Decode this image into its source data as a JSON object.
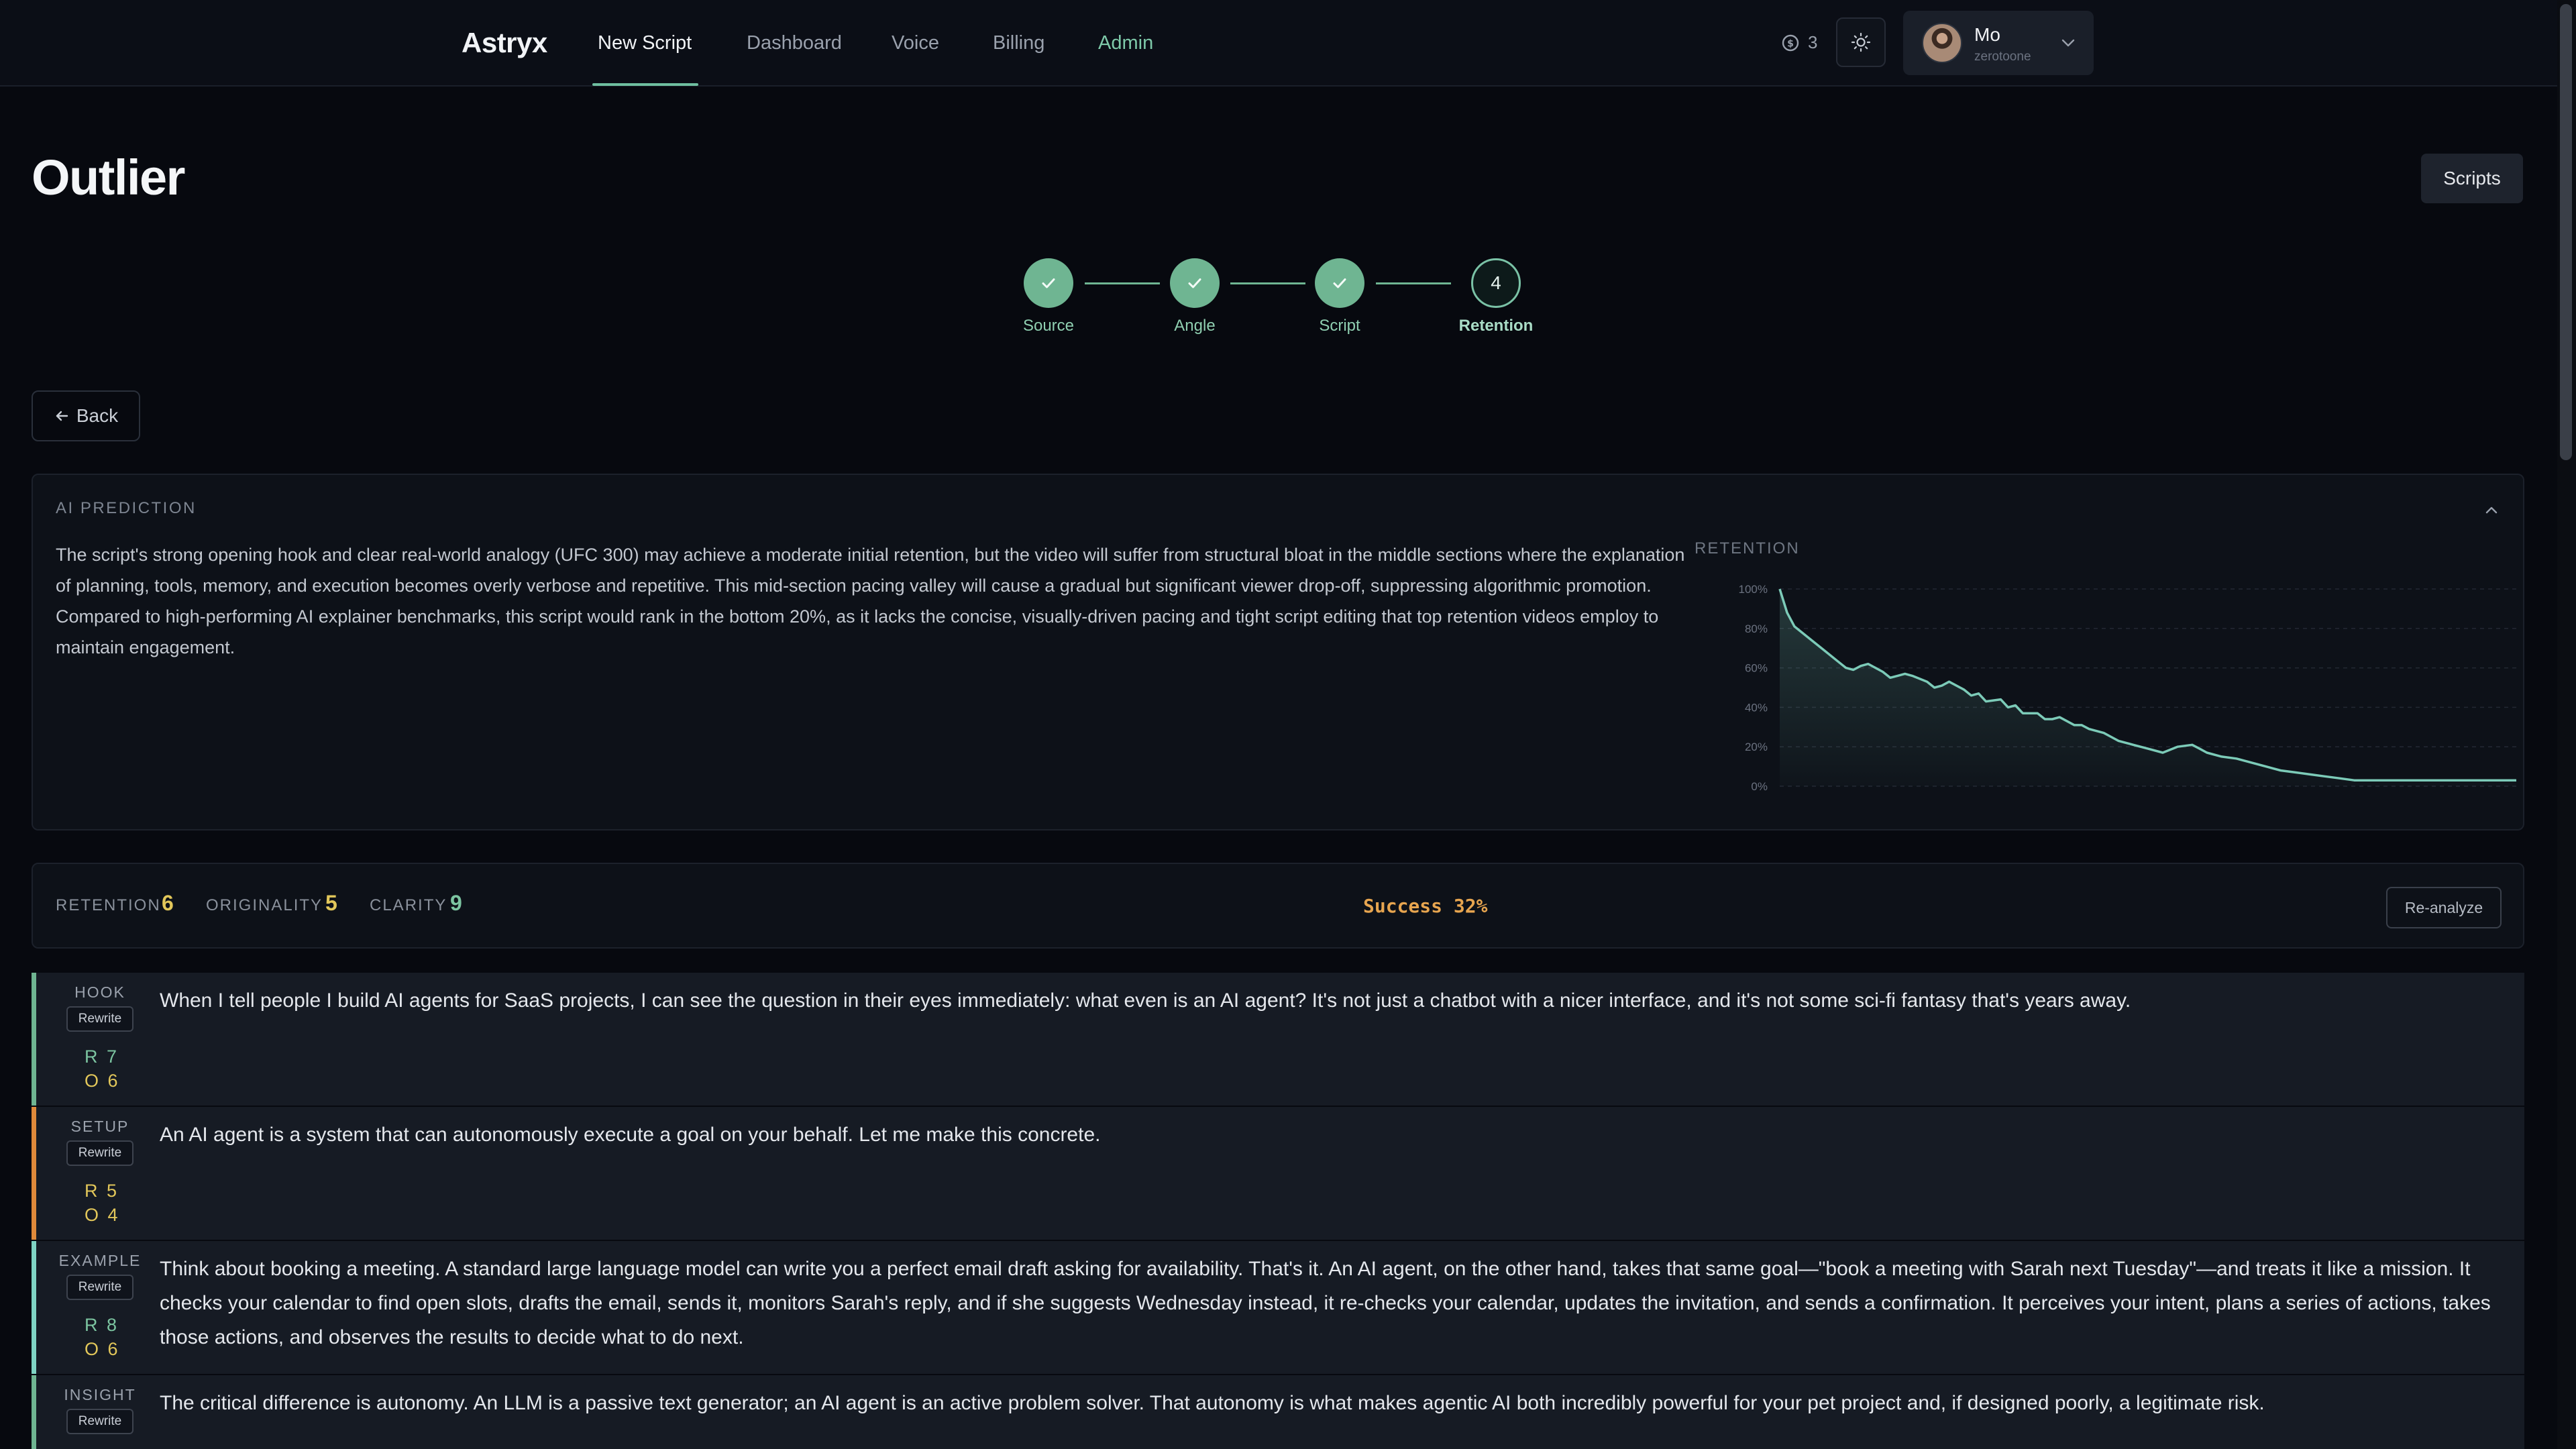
{
  "nav": {
    "brand": "Astryx",
    "items": [
      "New Script",
      "Dashboard",
      "Voice",
      "Billing",
      "Admin"
    ],
    "credits": "3",
    "user": {
      "name": "Mo",
      "handle": "zerotoone"
    }
  },
  "page": {
    "title": "Outlier",
    "scripts_button": "Scripts",
    "back_button": "Back"
  },
  "stepper": {
    "steps": [
      {
        "label": "Source",
        "state": "done"
      },
      {
        "label": "Angle",
        "state": "done"
      },
      {
        "label": "Script",
        "state": "done"
      },
      {
        "label": "Retention",
        "state": "current",
        "number": "4"
      }
    ]
  },
  "prediction": {
    "title": "AI PREDICTION",
    "text": "The script's strong opening hook and clear real-world analogy (UFC 300) may achieve a moderate initial retention, but the video will suffer from structural bloat in the middle sections where the explanation of planning, tools, memory, and execution becomes overly verbose and repetitive. This mid-section pacing valley will cause a gradual but significant viewer drop-off, suppressing algorithmic promotion. Compared to high-performing AI explainer benchmarks, this script would rank in the bottom 20%, as it lacks the concise, visually-driven pacing and tight script editing that top retention videos employ to maintain engagement.",
    "chart_label": "RETENTION"
  },
  "chart_data": {
    "type": "area",
    "title": "RETENTION",
    "xlabel": "",
    "ylabel": "",
    "y_ticks": [
      "100%",
      "80%",
      "60%",
      "40%",
      "20%",
      "0%"
    ],
    "ylim": [
      0,
      100
    ],
    "xlim": [
      0,
      100
    ],
    "grid": true,
    "line_color": "#7ccbb8",
    "series": [
      {
        "x": [
          0,
          1,
          2,
          4,
          6,
          8,
          9,
          10,
          11,
          12,
          14,
          15,
          16,
          17,
          18,
          20,
          21,
          22,
          23,
          25,
          26,
          27,
          28,
          30,
          31,
          32,
          33,
          35,
          36,
          37,
          38,
          40,
          41,
          42,
          44,
          45,
          46,
          48,
          50,
          52,
          54,
          56,
          57,
          58,
          60,
          62,
          64,
          66,
          68,
          70,
          72,
          74,
          76,
          78,
          80,
          82,
          84,
          86,
          88,
          90,
          92,
          94,
          96,
          98,
          100
        ],
        "y": [
          100,
          88,
          81,
          75,
          69,
          63,
          60,
          59,
          61,
          62,
          58,
          55,
          56,
          57,
          56,
          53,
          50,
          51,
          53,
          49,
          46,
          47,
          43,
          44,
          40,
          41,
          37,
          37,
          34,
          34,
          35,
          31,
          31,
          29,
          27,
          25,
          23,
          21,
          19,
          17,
          20,
          21,
          19,
          17,
          15,
          14,
          12,
          10,
          8,
          7,
          6,
          5,
          4,
          3,
          3,
          3,
          3,
          3,
          3,
          3,
          3,
          3,
          3,
          3,
          3
        ]
      }
    ]
  },
  "scores": {
    "items": [
      {
        "label": "RETENTION",
        "value": "6",
        "color": "#e2c75a"
      },
      {
        "label": "ORIGINALITY",
        "value": "5",
        "color": "#e2c75a"
      },
      {
        "label": "CLARITY",
        "value": "9",
        "color": "#7cc5a1"
      }
    ],
    "success": "Success 32%",
    "reanalyze_button": "Re-analyze"
  },
  "sections": [
    {
      "tag": "HOOK",
      "rewrite": "Rewrite",
      "r": "R 7",
      "o": "O 6",
      "border": "#6fb592",
      "r_color": "#7cc5a1",
      "o_color": "#e2c75a",
      "text": "When I tell people I build AI agents for SaaS projects, I can see the question in their eyes immediately: what even is an AI agent? It's not just a chatbot with a nicer interface, and it's not some sci-fi fantasy that's years away."
    },
    {
      "tag": "SETUP",
      "rewrite": "Rewrite",
      "r": "R 5",
      "o": "O 4",
      "border": "#e08a3a",
      "r_color": "#e2c75a",
      "o_color": "#e2c75a",
      "text": "An AI agent is a system that can autonomously execute a goal on your behalf. Let me make this concrete."
    },
    {
      "tag": "EXAMPLE",
      "rewrite": "Rewrite",
      "r": "R 8",
      "o": "O 6",
      "border": "#7fd4c4",
      "r_color": "#7cc5a1",
      "o_color": "#e2c75a",
      "text": "Think about booking a meeting. A standard large language model can write you a perfect email draft asking for availability. That's it. An AI agent, on the other hand, takes that same goal—\"book a meeting with Sarah next Tuesday\"—and treats it like a mission. It checks your calendar to find open slots, drafts the email, sends it, monitors Sarah's reply, and if she suggests Wednesday instead, it re-checks your calendar, updates the invitation, and sends a confirmation. It perceives your intent, plans a series of actions, takes those actions, and observes the results to decide what to do next."
    },
    {
      "tag": "INSIGHT",
      "rewrite": "Rewrite",
      "r": "",
      "o": "",
      "border": "#6fb592",
      "r_color": "#7cc5a1",
      "o_color": "#e2c75a",
      "text": "The critical difference is autonomy. An LLM is a passive text generator; an AI agent is an active problem solver. That autonomy is what makes agentic AI both incredibly powerful for your pet project and, if designed poorly, a legitimate risk."
    }
  ]
}
